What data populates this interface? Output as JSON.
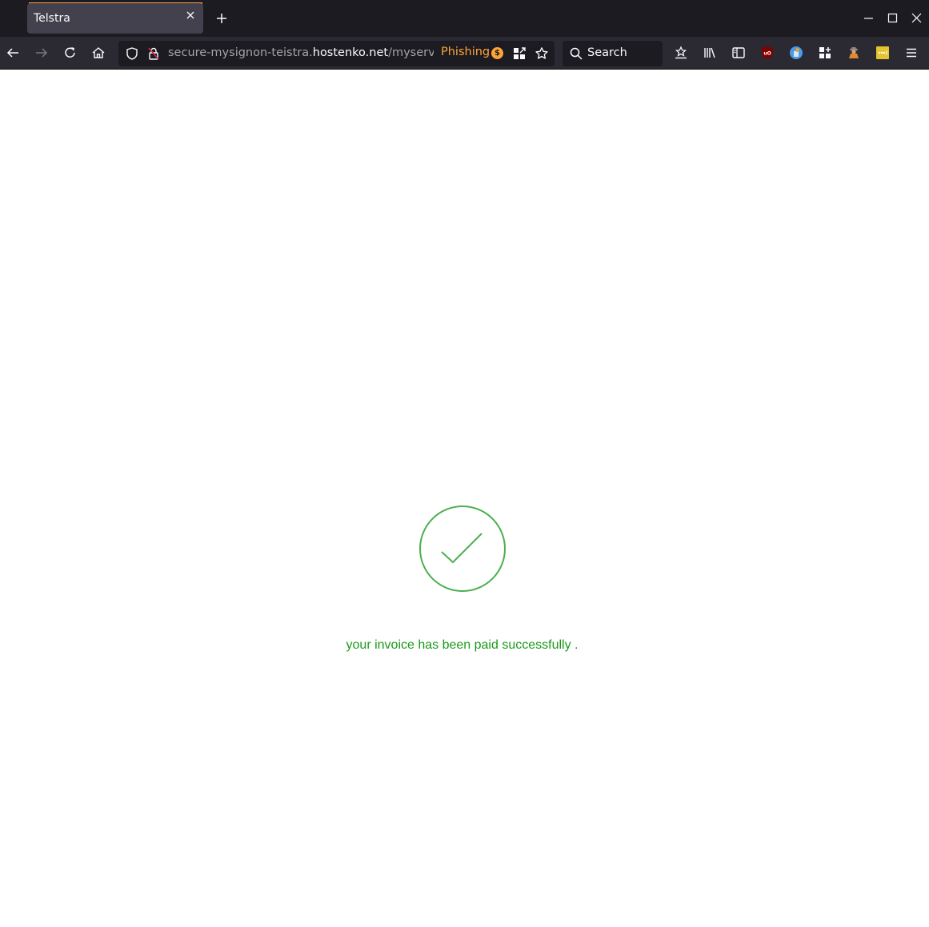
{
  "browser": {
    "tabs": [
      {
        "title": "Telstra",
        "active": true
      }
    ],
    "new_tab_label": "+",
    "url": {
      "prefix": "secure-mysignon-teistra.",
      "host": "hostenko.net",
      "path": "/myservic"
    },
    "security_warning": "Phishing",
    "warning_badge_symbol": "$",
    "search_placeholder": "Search",
    "icons": {
      "back": "back-arrow-icon",
      "forward": "forward-arrow-icon",
      "reload": "reload-icon",
      "home": "home-icon",
      "tracking_protection": "shield-icon",
      "insecure_lock": "insecure-lock-icon",
      "qr": "qr-code-icon",
      "bookmark": "star-icon",
      "pocket": "save-to-pocket-icon",
      "library": "library-icon",
      "sidebar": "sidebar-icon",
      "ublock": "ublock-origin-icon",
      "cookie_extension": "cookie-autodelete-icon",
      "extensions": "extensions-icon",
      "privacy_extension": "spy-extension-icon",
      "bitwarden_like": "password-manager-icon",
      "menu": "hamburger-menu-icon"
    },
    "colors": {
      "titlebar": "#1c1b22",
      "toolbar": "#2b2a33",
      "tab_accent": "#ff9a3c",
      "warning": "#ffa436"
    }
  },
  "page": {
    "status_icon": "success-check-icon",
    "message": "your invoice has been paid successfully .",
    "colors": {
      "check": "#4caf50",
      "message": "#1a9b1a"
    }
  }
}
